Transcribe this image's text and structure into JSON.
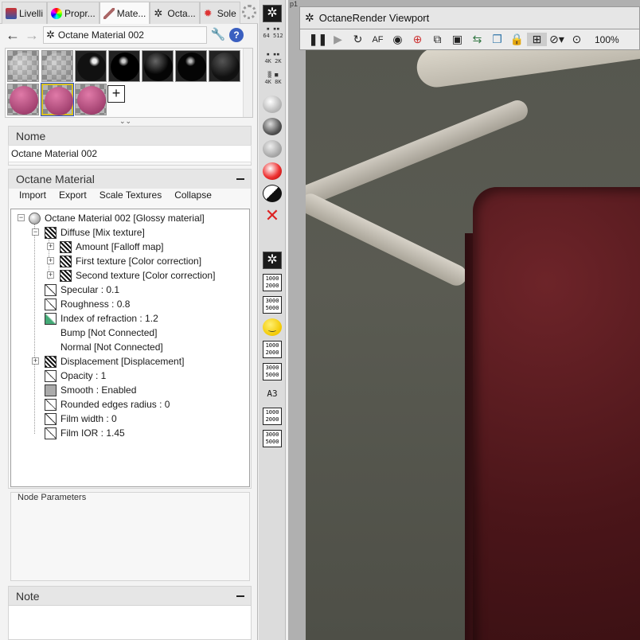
{
  "tabs": [
    {
      "label": "Livelli",
      "active": false
    },
    {
      "label": "Propr...",
      "active": false
    },
    {
      "label": "Mate...",
      "active": true
    },
    {
      "label": "Octa...",
      "active": false
    },
    {
      "label": "Sole",
      "active": false
    }
  ],
  "nav": {
    "material_name": "Octane Material 002"
  },
  "nome": {
    "header": "Nome",
    "value": "Octane Material 002"
  },
  "octane_material": {
    "header": "Octane Material",
    "toolbar": [
      "Import",
      "Export",
      "Scale Textures",
      "Collapse"
    ],
    "tree": [
      {
        "text": "Octane Material 002  [Glossy material]"
      },
      {
        "text": "Diffuse  [Mix texture]"
      },
      {
        "text": "Amount  [Falloff map]"
      },
      {
        "text": "First texture  [Color correction]"
      },
      {
        "text": "Second texture  [Color correction]"
      },
      {
        "text": "Specular : 0.1"
      },
      {
        "text": "Roughness : 0.8"
      },
      {
        "text": "Index of refraction : 1.2"
      },
      {
        "text": "Bump  [Not Connected]"
      },
      {
        "text": "Normal  [Not Connected]"
      },
      {
        "text": "Displacement  [Displacement]"
      },
      {
        "text": "Opacity : 1"
      },
      {
        "text": "Smooth : Enabled"
      },
      {
        "text": "Rounded edges radius : 0"
      },
      {
        "text": "Film width : 0"
      },
      {
        "text": "Film IOR : 1.45"
      }
    ]
  },
  "node_parameters": {
    "title": "Node Parameters"
  },
  "note": {
    "header": "Note"
  },
  "strip": {
    "res_labels": [
      "64",
      "512",
      "4K",
      "2K",
      "4K",
      "8K"
    ],
    "res_buttons": [
      "1000\n2000",
      "3000\n5000",
      "1000\n2000",
      "3000\n5000",
      "1000\n2000",
      "3000\n5000"
    ],
    "a3_label": "A3"
  },
  "viewport": {
    "p1_label": "p1",
    "title": "OctaneRender Viewport",
    "zoom": "100%"
  },
  "colors": {
    "accent_help": "#3a5fc0",
    "towel": "#4a1519"
  }
}
